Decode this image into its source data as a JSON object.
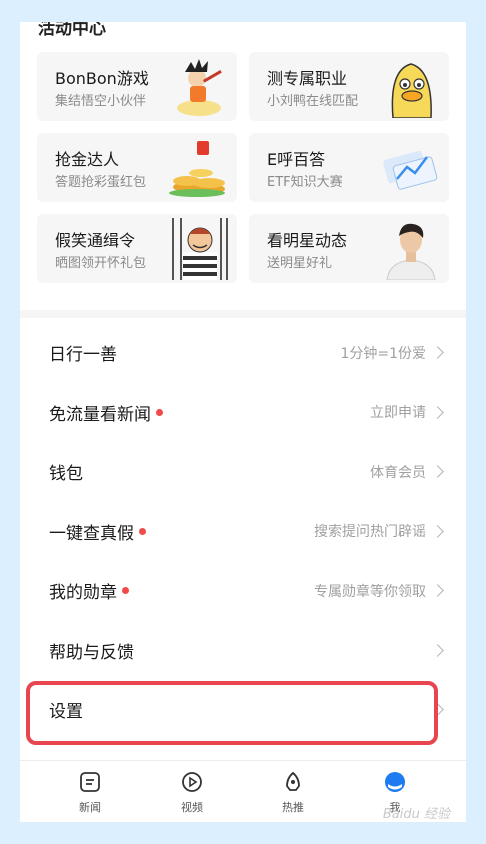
{
  "section": {
    "title": "活动中心"
  },
  "cards": [
    {
      "title": "BonBon游戏",
      "subtitle": "集结悟空小伙伴",
      "icon": "goku-cartoon-icon"
    },
    {
      "title": "测专属职业",
      "subtitle": "小刘鸭在线匹配",
      "icon": "duck-cartoon-icon"
    },
    {
      "title": "抢金达人",
      "subtitle": "答题抢彩蛋红包",
      "icon": "gold-coins-icon"
    },
    {
      "title": "E呼百答",
      "subtitle": "ETF知识大赛",
      "icon": "chart-cards-icon"
    },
    {
      "title": "假笑通缉令",
      "subtitle": "晒图领开怀礼包",
      "icon": "prisoner-cartoon-icon"
    },
    {
      "title": "看明星动态",
      "subtitle": "送明星好礼",
      "icon": "celebrity-photo"
    }
  ],
  "menu": [
    {
      "label": "日行一善",
      "hint": "1分钟=1份爱",
      "dot": false
    },
    {
      "label": "免流量看新闻",
      "hint": "立即申请",
      "dot": true
    },
    {
      "label": "钱包",
      "hint": "体育会员",
      "dot": false
    },
    {
      "label": "一键查真假",
      "hint": "搜索提问热门辟谣",
      "dot": true
    },
    {
      "label": "我的勋章",
      "hint": "专属勋章等你领取",
      "dot": true
    },
    {
      "label": "帮助与反馈",
      "hint": "",
      "dot": false
    },
    {
      "label": "设置",
      "hint": "",
      "dot": false
    }
  ],
  "tabs": [
    {
      "label": "新闻",
      "icon": "news-icon"
    },
    {
      "label": "视频",
      "icon": "play-icon"
    },
    {
      "label": "热推",
      "icon": "rocket-icon"
    },
    {
      "label": "我",
      "icon": "profile-icon",
      "active": true
    }
  ],
  "colors": {
    "accent": "#1f7cf0",
    "dot": "#ef4b4b",
    "highlight": "#e8454f"
  }
}
